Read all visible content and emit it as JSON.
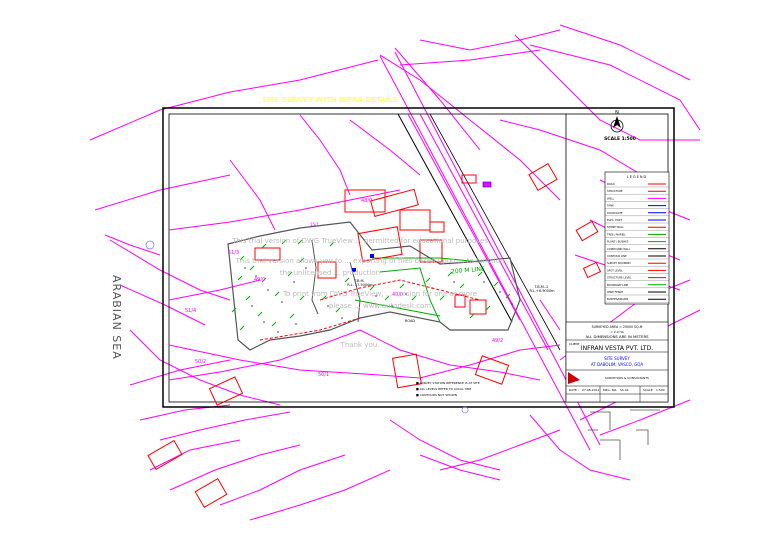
{
  "header": {
    "title": "SITE SURVEY WITH INFRA DETAILS"
  },
  "map": {
    "sea_label": "ARABIAN SEA",
    "scale_label": "SCALE 1:500",
    "survey_numbers": [
      "51/3",
      "51/4",
      "50/2",
      "50/1",
      "48/0",
      "49/0",
      "49/2",
      "50/2",
      "40/0",
      "49/0",
      "15/1"
    ],
    "line_label": "200 M LINE",
    "line_label_small": "100 M LINE",
    "tbm_left": "T.B.M.\nR.L. 17.5000m",
    "tbm_right": "T.B.M.-2\nR.L.+6.9000m",
    "north_label": "N",
    "road_label": "ROAD",
    "notes": [
      "■ SURVEY STATION REFERENCE IS AT SITE",
      "■ ALL LEVELS REFER TO LOCAL TBM",
      "■ CONTOURS NOT SHOWN"
    ]
  },
  "watermark": {
    "line1": "This trial version of DWG TrueView ... permitted for educational purposes",
    "line2": "This trial version allows you to ... exporting of files based upon ... to function",
    "line3": "the unlicensed ... production",
    "line4": "To print from DWG TrueView, ... version for one or more",
    "line5": "please ... www.autodesk.com",
    "line6": "Thank you."
  },
  "legend": {
    "title": "LEGEND",
    "items": [
      {
        "label": "ROAD",
        "color": "#ff0000"
      },
      {
        "label": "STRUCTURE",
        "color": "#ff0000"
      },
      {
        "label": "WELL",
        "color": "#ff00ff"
      },
      {
        "label": "TANK",
        "color": "#0000ff"
      },
      {
        "label": "DOOR/GATE",
        "color": "#0000ff"
      },
      {
        "label": "ELEC. POST",
        "color": "#0000ff"
      },
      {
        "label": "STONE WALL",
        "color": "#ff0000"
      },
      {
        "label": "TREE / NARIEL",
        "color": "#00aa00"
      },
      {
        "label": "PLANT / BUSHES",
        "color": "#00aa00"
      },
      {
        "label": "COMPOUND WALL",
        "color": "#000000"
      },
      {
        "label": "CONTOUR LINE",
        "color": "#000000"
      },
      {
        "label": "SURVEY BOUNDRY",
        "color": "#ff0000"
      },
      {
        "label": "SPOT LEVEL",
        "color": "#ff0000"
      },
      {
        "label": "STRUCTURE LEVEL",
        "color": "#ff0000"
      },
      {
        "label": "BOUNDARY LINE",
        "color": "#00aa00"
      },
      {
        "label": "WIRE FENCE",
        "color": "#000000"
      },
      {
        "label": "BUSHES/DRAINS",
        "color": "#000000"
      }
    ]
  },
  "title_block": {
    "area_line": "SURVEYED AREA = 20000 SQ.M",
    "area_sub": "= 2.0 HA",
    "dims_note": "ALL DIMENSIONS ARE IN METERS",
    "client_label": "CLIENT :",
    "client": "INFRAN VESTA PVT. LTD.",
    "project_line1": "SITE SURVEY",
    "project_line2": "AT DABOLIM, VASCO, GOA",
    "company": "SURVEYORS & CONSULTANTS",
    "date_label": "DATE :",
    "date": "27-08-2011",
    "drawing_label": "DRG. NO.",
    "drawing": "SS-01",
    "scale_label": "SCALE",
    "scale": "1:500"
  },
  "colors": {
    "boundary": "#ff00ff",
    "structure": "#ff0000",
    "tree": "#00aa00",
    "frame": "#000000",
    "title_text": "#ffff66"
  }
}
